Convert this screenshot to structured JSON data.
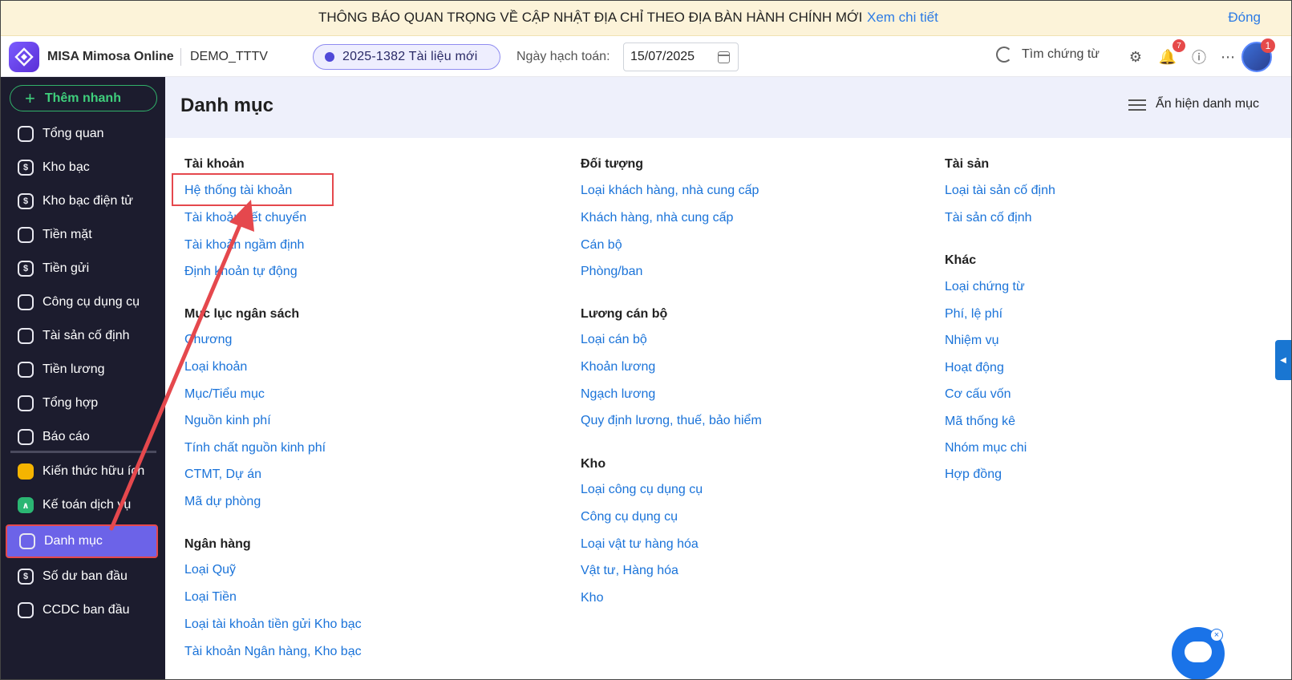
{
  "banner": {
    "text": "THÔNG BÁO QUAN TRỌNG VỀ CẬP NHẬT ĐỊA CHỈ THEO ĐỊA BÀN HÀNH CHÍNH MỚI",
    "link": "Xem chi tiết",
    "close": "Đóng"
  },
  "header": {
    "app_name": "MISA Mimosa Online",
    "company": "DEMO_TTTV",
    "doc_pill": "2025-1382 Tài liệu mới",
    "date_label": "Ngày hạch toán:",
    "date_value": "15/07/2025",
    "search_doc": "Tìm chứng từ",
    "notifications_count": "7",
    "avatar_badge": "1"
  },
  "sidebar": {
    "quick_add": "Thêm nhanh",
    "items": [
      {
        "label": "Tổng quan"
      },
      {
        "label": "Kho bạc"
      },
      {
        "label": "Kho bạc điện tử"
      },
      {
        "label": "Tiền mặt"
      },
      {
        "label": "Tiền gửi"
      },
      {
        "label": "Công cụ dụng cụ"
      },
      {
        "label": "Tài sản cố định"
      },
      {
        "label": "Tiền lương"
      },
      {
        "label": "Tổng hợp"
      },
      {
        "label": "Báo cáo"
      },
      {
        "label": "Kiến thức hữu ích"
      },
      {
        "label": "Kế toán dịch vụ"
      },
      {
        "label": "Danh mục"
      },
      {
        "label": "Số dư ban đầu"
      },
      {
        "label": "CCDC ban đầu"
      }
    ]
  },
  "main": {
    "title": "Danh mục",
    "toggle_label": "Ẩn hiện danh mục",
    "col1": {
      "g1_title": "Tài khoản",
      "g1": [
        "Hệ thống tài khoản",
        "Tài khoản kết chuyển",
        "Tài khoản ngầm định",
        "Định khoản tự động"
      ],
      "g2_title": "Mục lục ngân sách",
      "g2": [
        "Chương",
        "Loại khoản",
        "Mục/Tiểu mục",
        "Nguồn kinh phí",
        "Tính chất nguồn kinh phí",
        "CTMT, Dự án",
        "Mã dự phòng"
      ],
      "g3_title": "Ngân hàng",
      "g3": [
        "Loại Quỹ",
        "Loại Tiền",
        "Loại tài khoản tiền gửi Kho bạc",
        "Tài khoản Ngân hàng, Kho bạc"
      ]
    },
    "col2": {
      "g1_title": "Đối tượng",
      "g1": [
        "Loại khách hàng, nhà cung cấp",
        "Khách hàng, nhà cung cấp",
        "Cán bộ",
        "Phòng/ban"
      ],
      "g2_title": "Lương cán bộ",
      "g2": [
        "Loại cán bộ",
        "Khoản lương",
        "Ngạch lương",
        "Quy định lương, thuế, bảo hiểm"
      ],
      "g3_title": "Kho",
      "g3": [
        "Loại công cụ dụng cụ",
        "Công cụ dụng cụ",
        "Loại vật tư hàng hóa",
        "Vật tư, Hàng hóa",
        "Kho"
      ]
    },
    "col3": {
      "g1_title": "Tài sản",
      "g1": [
        "Loại tài sản cố định",
        "Tài sản cố định"
      ],
      "g2_title": "Khác",
      "g2": [
        "Loại chứng từ",
        "Phí, lệ phí",
        "Nhiệm vụ",
        "Hoạt động",
        "Cơ cấu vốn",
        "Mã thống kê",
        "Nhóm mục chi",
        "Hợp đồng"
      ]
    }
  },
  "colors": {
    "sidebar_bg": "#1c1c2e",
    "active": "#6c63e8",
    "link": "#1a73d9",
    "highlight": "#e5484d"
  }
}
